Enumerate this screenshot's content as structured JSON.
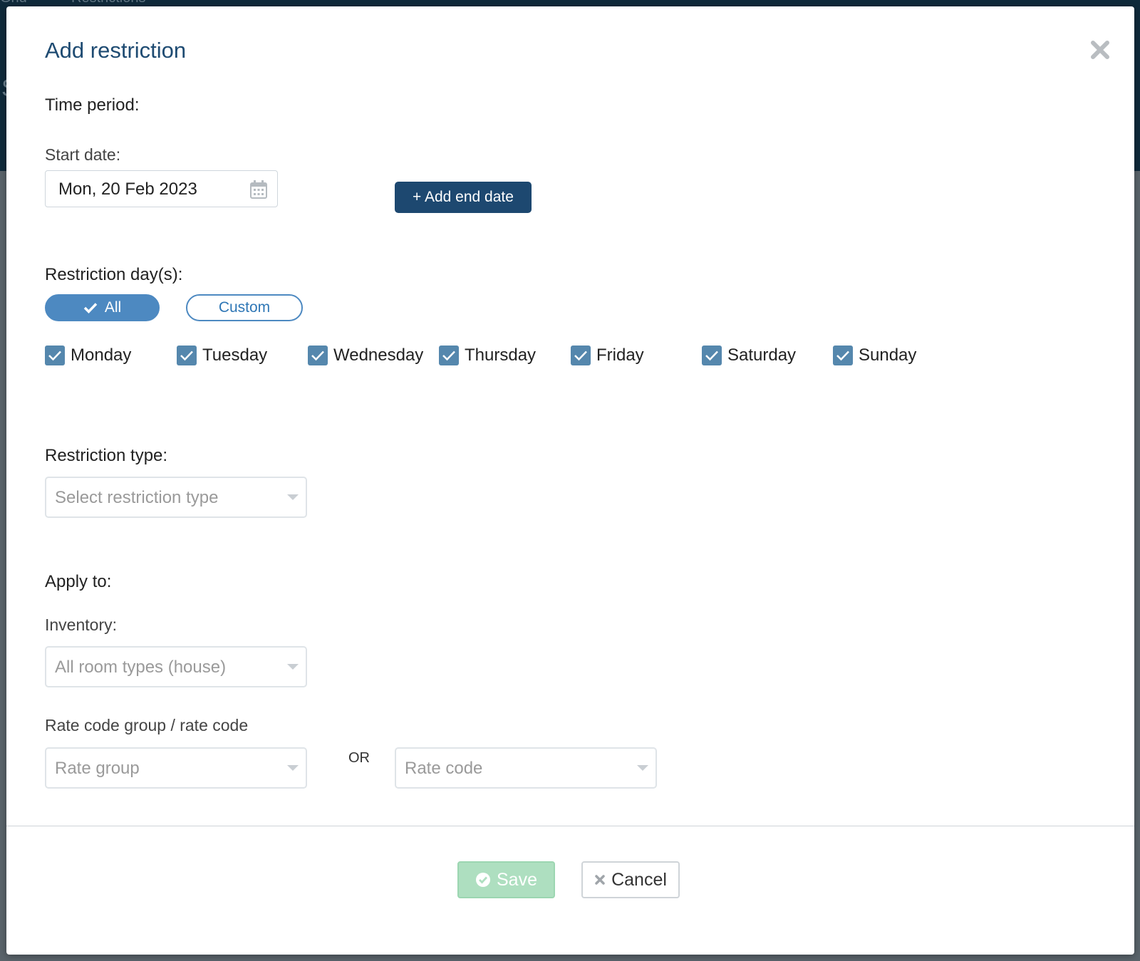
{
  "background": {
    "tabs": [
      "Grid",
      "Restrictions"
    ],
    "letter": "S"
  },
  "modal": {
    "title": "Add restriction",
    "close_icon": "close-icon"
  },
  "time_period": {
    "heading": "Time period:",
    "start_label": "Start date:",
    "start_value": "Mon, 20 Feb 2023",
    "calendar_icon": "calendar-icon",
    "add_end_label": "+ Add end date"
  },
  "days": {
    "heading": "Restriction day(s):",
    "all_label": "All",
    "custom_label": "Custom",
    "selected_mode": "All",
    "items": [
      {
        "label": "Monday",
        "checked": true
      },
      {
        "label": "Tuesday",
        "checked": true
      },
      {
        "label": "Wednesday",
        "checked": true
      },
      {
        "label": "Thursday",
        "checked": true
      },
      {
        "label": "Friday",
        "checked": true
      },
      {
        "label": "Saturday",
        "checked": true
      },
      {
        "label": "Sunday",
        "checked": true
      }
    ]
  },
  "restriction_type": {
    "heading": "Restriction type:",
    "placeholder": "Select restriction type"
  },
  "apply_to": {
    "heading": "Apply to:",
    "inventory_label": "Inventory:",
    "inventory_value": "All room types (house)",
    "rate_label": "Rate code group / rate code",
    "rate_group_placeholder": "Rate group",
    "or_label": "OR",
    "rate_code_placeholder": "Rate code"
  },
  "footer": {
    "save_label": "Save",
    "cancel_label": "Cancel"
  },
  "colors": {
    "title": "#1e4b72",
    "primary": "#1d4870",
    "pill": "#4d89c1",
    "checkbox": "#5587ad",
    "save": "#aedfc0"
  }
}
